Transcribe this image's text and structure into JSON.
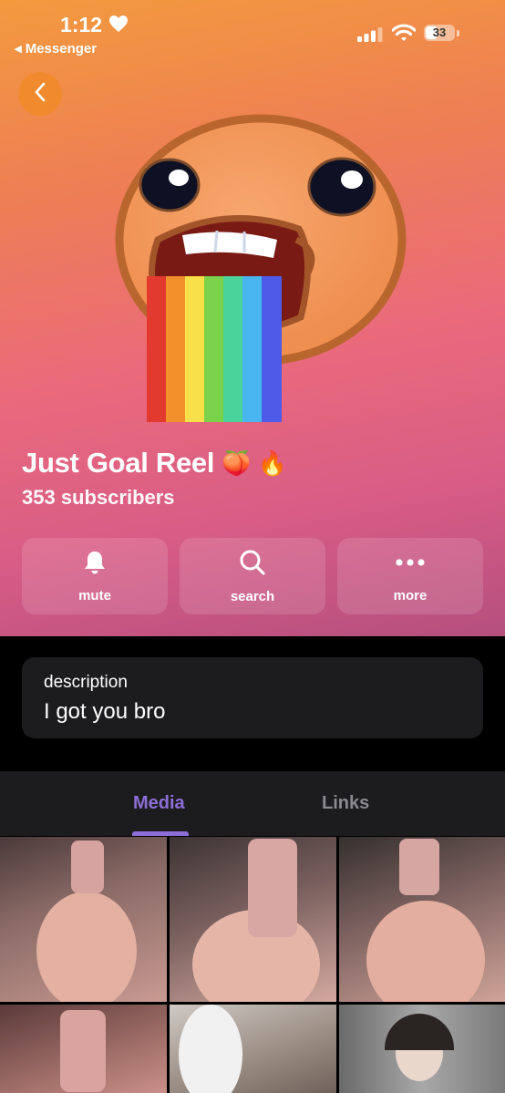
{
  "status_bar": {
    "time": "1:12",
    "back_app": "Messenger",
    "battery": "33"
  },
  "channel": {
    "name": "Just Goal Reel",
    "emoji": "🍑 🔥",
    "subscribers": "353 subscribers"
  },
  "actions": [
    {
      "label": "mute",
      "icon": "bell-icon"
    },
    {
      "label": "search",
      "icon": "search-icon"
    },
    {
      "label": "more",
      "icon": "more-icon"
    }
  ],
  "description": {
    "label": "description",
    "value": "I got you bro"
  },
  "tabs": [
    {
      "label": "Media",
      "active": true
    },
    {
      "label": "Links",
      "active": false
    }
  ],
  "colors": {
    "accent": "#8e6fd8",
    "back_button": "#f08a2c",
    "card": "#1c1c1e"
  }
}
